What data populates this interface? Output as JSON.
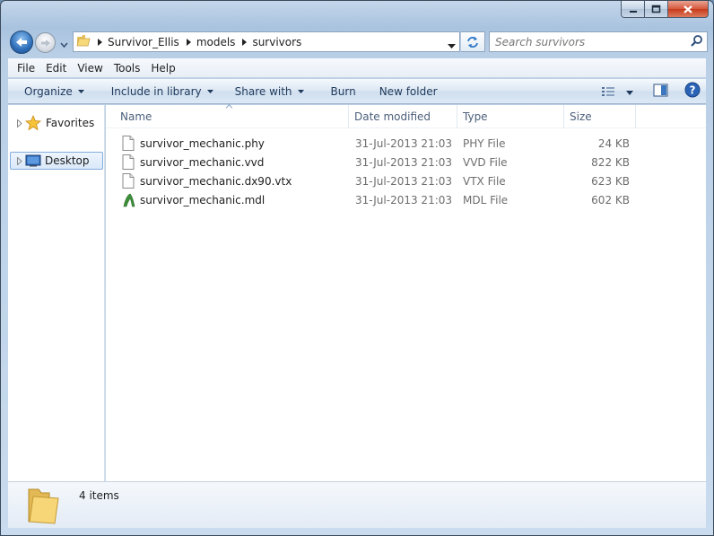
{
  "address": {
    "crumbs": [
      "Survivor_Ellis",
      "models",
      "survivors"
    ]
  },
  "search": {
    "placeholder": "Search survivors"
  },
  "menu": [
    "File",
    "Edit",
    "View",
    "Tools",
    "Help"
  ],
  "commands": {
    "organize": "Organize",
    "include_in_library": "Include in library",
    "share_with": "Share with",
    "burn": "Burn",
    "new_folder": "New folder"
  },
  "nav": {
    "favorites": "Favorites",
    "desktop": "Desktop"
  },
  "columns": {
    "name": "Name",
    "date_modified": "Date modified",
    "type": "Type",
    "size": "Size"
  },
  "files": [
    {
      "name": "survivor_mechanic.phy",
      "date": "31-Jul-2013 21:03",
      "type": "PHY File",
      "size": "24 KB",
      "icon": "document-icon"
    },
    {
      "name": "survivor_mechanic.vvd",
      "date": "31-Jul-2013 21:03",
      "type": "VVD File",
      "size": "822 KB",
      "icon": "document-icon"
    },
    {
      "name": "survivor_mechanic.dx90.vtx",
      "date": "31-Jul-2013 21:03",
      "type": "VTX File",
      "size": "623 KB",
      "icon": "document-icon"
    },
    {
      "name": "survivor_mechanic.mdl",
      "date": "31-Jul-2013 21:03",
      "type": "MDL File",
      "size": "602 KB",
      "icon": "model-icon"
    }
  ],
  "status": {
    "item_count": "4 items"
  },
  "colors": {
    "accent": "#2f6fb9",
    "command_text": "#1e395b",
    "selection_border": "#84acdd"
  }
}
